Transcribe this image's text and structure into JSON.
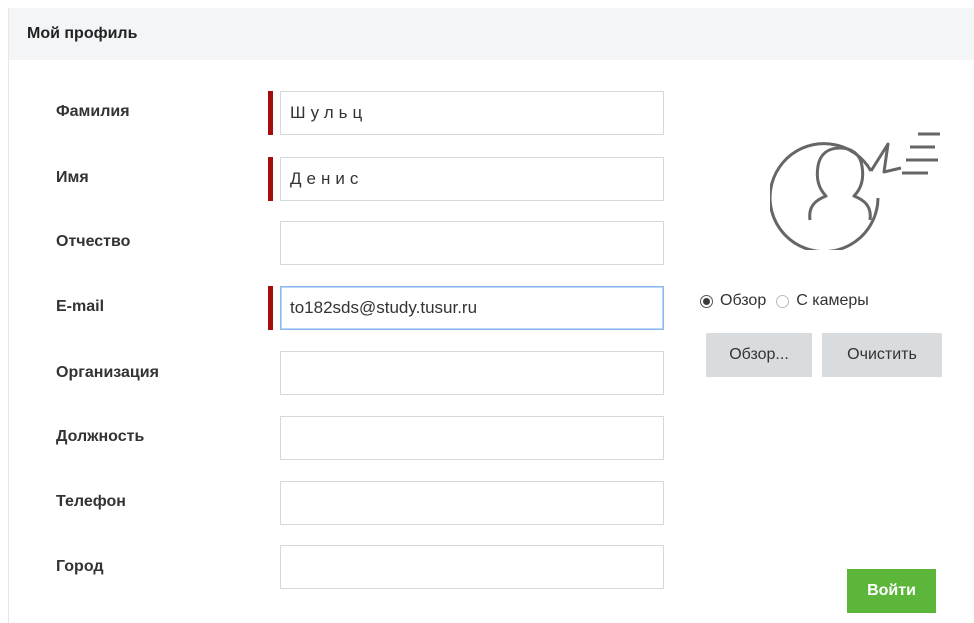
{
  "header": {
    "title": "Мой профиль"
  },
  "form": {
    "fields": [
      {
        "label": "Фамилия",
        "value": "Шульц",
        "placeholder": "",
        "required": true
      },
      {
        "label": "Имя",
        "value": "Денис",
        "placeholder": "",
        "required": true
      },
      {
        "label": "Отчество",
        "value": "",
        "placeholder": "",
        "required": false
      },
      {
        "label": "E-mail",
        "value": "to182sds@study.tusur.ru",
        "placeholder": "",
        "required": true
      },
      {
        "label": "Организация",
        "value": "",
        "placeholder": "",
        "required": false
      },
      {
        "label": "Должность",
        "value": "",
        "placeholder": "",
        "required": false
      },
      {
        "label": "Телефон",
        "value": "",
        "placeholder": "",
        "required": false
      },
      {
        "label": "Город",
        "value": "",
        "placeholder": "",
        "required": false
      }
    ]
  },
  "photo": {
    "icon": "user-profile-icon",
    "source_options": [
      {
        "label": "Обзор",
        "checked": true
      },
      {
        "label": "С камеры",
        "checked": false
      }
    ],
    "browse_label": "Обзор...",
    "clear_label": "Очистить"
  },
  "submit": {
    "label": "Войти"
  },
  "colors": {
    "required_marker": "#a50d0d",
    "submit_bg": "#5bb63a",
    "header_bg": "#f3f5f7",
    "button_gray": "#d9dcde",
    "focus_border": "#89b8ef"
  }
}
